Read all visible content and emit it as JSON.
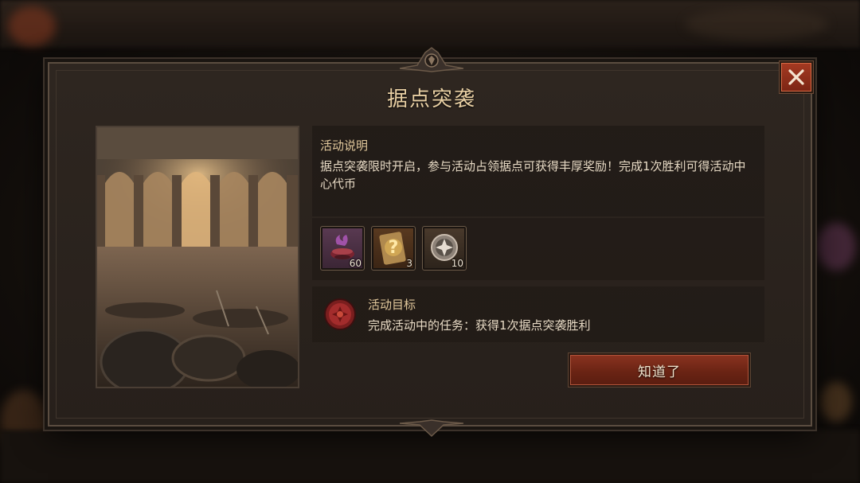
{
  "dialog": {
    "title": "据点突袭",
    "description_label": "活动说明",
    "description_text": "据点突袭限时开启，参与活动占领据点可获得丰厚奖励！完成1次胜利可得活动中心代币",
    "rewards": [
      {
        "icon": "purple-incense-bowl-icon",
        "count": "60"
      },
      {
        "icon": "mystery-scroll-icon",
        "count": "3"
      },
      {
        "icon": "silver-token-icon",
        "count": "10"
      }
    ],
    "goal_label": "活动目标",
    "goal_text": "完成活动中的任务：获得1次据点突袭胜利",
    "confirm_label": "知道了",
    "close_icon": "close-icon"
  },
  "colors": {
    "title": "#e8cfa3",
    "accent_red": "#8a3320",
    "panel": "#2e2620"
  }
}
